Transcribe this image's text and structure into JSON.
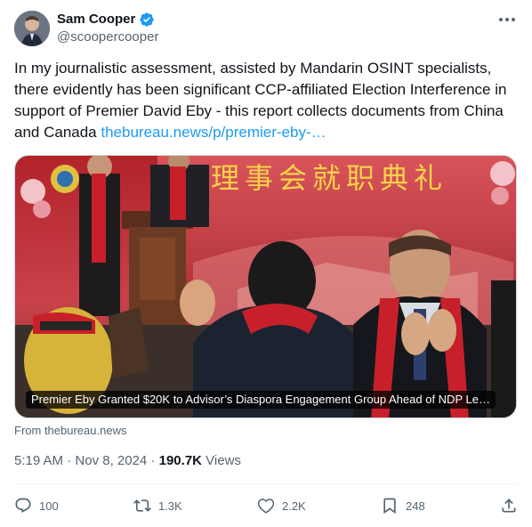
{
  "author": {
    "display_name": "Sam Cooper",
    "handle": "@scoopercooper",
    "verified_color": "#1d9bf0"
  },
  "tweet": {
    "text": "In my journalistic assessment, assisted by Mandarin OSINT specialists, there evidently has been significant CCP-affiliated Election Interference in support of Premier David Eby - this report collects documents from China and Canada ",
    "link_text": "thebureau.news/p/premier-eby-…"
  },
  "card": {
    "headline": "Premier Eby Granted $20K to Advisor’s Diaspora Engagement Group Ahead of NDP Le…",
    "banner_text": "理事会就职典礼",
    "source": "From thebureau.news"
  },
  "meta": {
    "time": "5:19 AM",
    "separator": "·",
    "date": "Nov 8, 2024",
    "views_count": "190.7K",
    "views_label": "Views"
  },
  "actions": {
    "replies": "100",
    "reposts": "1.3K",
    "likes": "2.2K",
    "bookmarks": "248"
  },
  "icons": [
    "verified-badge-icon",
    "more-icon",
    "reply-icon",
    "repost-icon",
    "like-icon",
    "bookmark-icon",
    "share-icon"
  ]
}
